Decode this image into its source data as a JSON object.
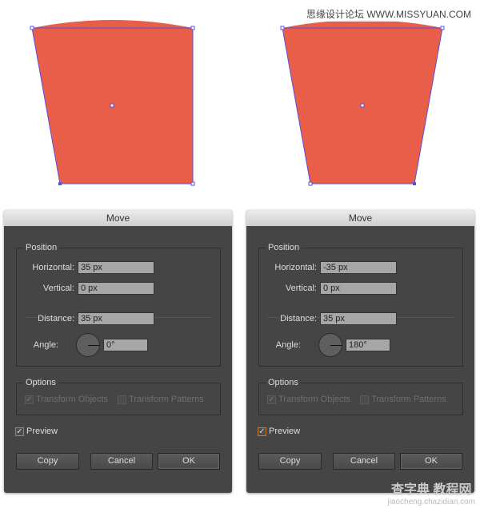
{
  "shape_color": "#e85e48",
  "selection_color": "#5a4fe0",
  "watermark_top": "思缘设计论坛 WWW.MISSYUAN.COM",
  "watermark_bottom": {
    "brand": "查字典 教程网",
    "url": "jiaocheng.chazidian.com"
  },
  "dialogs": [
    {
      "title": "Move",
      "position_label": "Position",
      "horizontal_label": "Horizontal:",
      "horizontal": "35 px",
      "vertical_label": "Vertical:",
      "vertical": "0 px",
      "distance_label": "Distance:",
      "distance": "35 px",
      "angle_label": "Angle:",
      "angle": "0°",
      "options_label": "Options",
      "transform_objects": "Transform Objects",
      "transform_patterns": "Transform Patterns",
      "preview": "Preview",
      "copy": "Copy",
      "cancel": "Cancel",
      "ok": "OK"
    },
    {
      "title": "Move",
      "position_label": "Position",
      "horizontal_label": "Horizontal:",
      "horizontal": "-35 px",
      "vertical_label": "Vertical:",
      "vertical": "0 px",
      "distance_label": "Distance:",
      "distance": "35 px",
      "angle_label": "Angle:",
      "angle": "180°",
      "options_label": "Options",
      "transform_objects": "Transform Objects",
      "transform_patterns": "Transform Patterns",
      "preview": "Preview",
      "copy": "Copy",
      "cancel": "Cancel",
      "ok": "OK"
    }
  ]
}
